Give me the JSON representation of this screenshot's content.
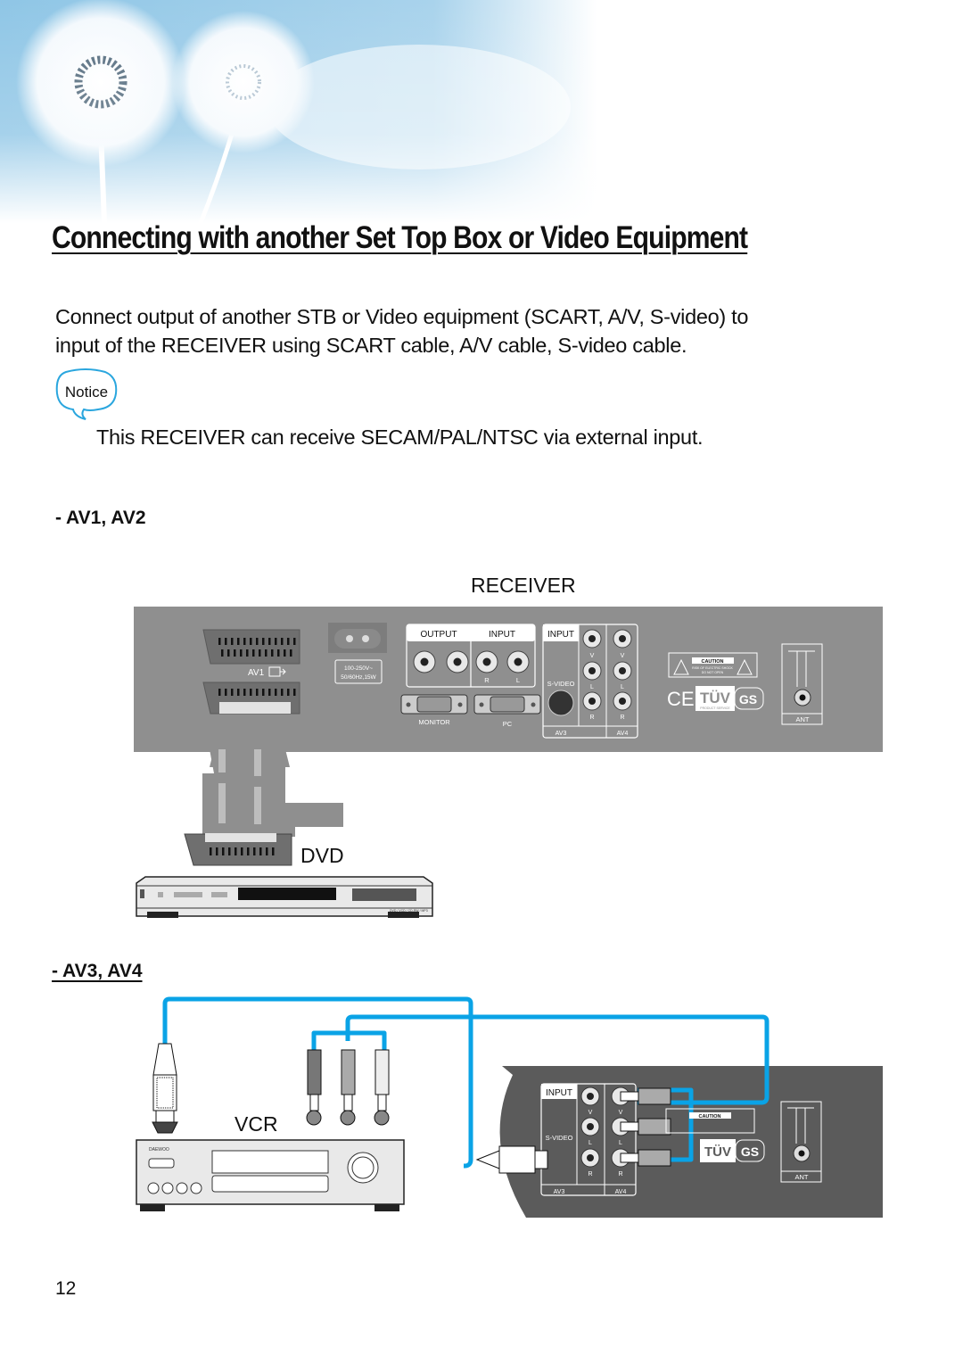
{
  "page": {
    "title": "Connecting with another Set Top Box or Video Equipment",
    "intro_line1": "Connect output of another STB or Video equipment (SCART, A/V, S-video) to",
    "intro_line2": "input of the RECEIVER using SCART cable, A/V cable, S-video cable.",
    "notice_badge": "Notice",
    "notice_text": "This RECEIVER can receive SECAM/PAL/NTSC via external input.",
    "page_number": "12"
  },
  "sections": [
    {
      "heading": "- AV1, AV2"
    },
    {
      "heading": "- AV3, AV4"
    }
  ],
  "diagram": {
    "receiver_label": "RECEIVER",
    "dvd_label": "DVD",
    "vcr_label": "VCR",
    "panel": {
      "av1_label": "AV1",
      "power_rating_line1": "100-250V~",
      "power_rating_line2": "50/60Hz,15W",
      "output_label": "OUTPUT",
      "input_label": "INPUT",
      "r_label": "R",
      "l_label": "L",
      "v_label": "V",
      "monitor_label": "MONITOR",
      "pc_label": "PC",
      "svideo_label": "S-VIDEO",
      "av3_label": "AV3",
      "av4_label": "AV4",
      "caution_label": "CAUTION",
      "caution_sub1": "RISK OF ELECTRIC SHOCK",
      "caution_sub2": "DO NOT OPEN",
      "ce_mark": "CE",
      "tuv_mark": "TÜV",
      "tuv_sub": "PRODUCT SERVICE",
      "gs_mark": "GS",
      "ant_label": "ANT"
    },
    "vcr_brand": "DAEWOO",
    "dvd_formats": "DVD / VCD / CD-RW / MP3",
    "colors": {
      "panel_gray": "#8f8f8f",
      "panel_dark": "#5b5b5b",
      "cable_blue": "#0aa3e6",
      "sky_blue": "#8fc6e6"
    }
  }
}
